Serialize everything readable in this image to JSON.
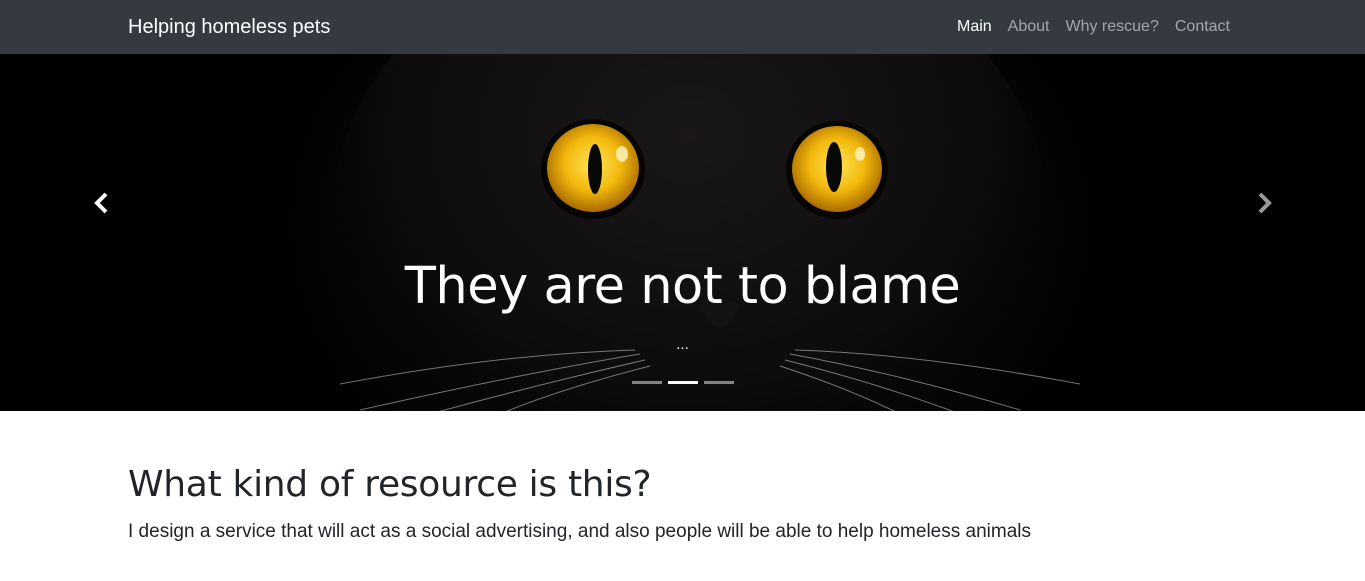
{
  "navbar": {
    "brand": "Helping homeless pets",
    "items": [
      {
        "label": "Main",
        "active": true
      },
      {
        "label": "About",
        "active": false
      },
      {
        "label": "Why rescue?",
        "active": false
      },
      {
        "label": "Contact",
        "active": false
      }
    ]
  },
  "carousel": {
    "slide_title": "They are not to blame",
    "slide_text": "...",
    "indicator_count": 3,
    "active_indicator": 2,
    "prev_icon": "chevron-left-icon",
    "next_icon": "chevron-right-icon"
  },
  "content": {
    "heading": "What kind of resource is this?",
    "text": "I design a service that will act as a social advertising, and also people will be able to help homeless animals"
  },
  "colors": {
    "navbar_bg": "#343a40",
    "nav_active": "#ffffff",
    "nav_inactive": "rgba(255,255,255,0.55)",
    "cat_eye": "#f0b800"
  }
}
